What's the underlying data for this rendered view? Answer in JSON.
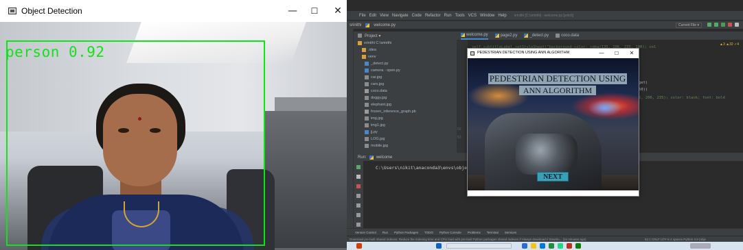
{
  "left_window": {
    "title": "Object Detection",
    "controls": {
      "minimize": "—",
      "maximize": "☐",
      "close": "✕"
    },
    "detection": {
      "label": "person 0.92",
      "box_color": "#15e01c"
    }
  },
  "ide": {
    "menu": [
      "File",
      "Edit",
      "View",
      "Navigate",
      "Code",
      "Refactor",
      "Run",
      "Tools",
      "VCS",
      "Window",
      "Help"
    ],
    "window_title": "srinithi [C:\\srinithi] - welcome.py [yolo5]",
    "breadcrumb": [
      "srinithi",
      "welcome.py"
    ],
    "nav_right": {
      "config": "Current File ▾"
    },
    "project_header": "Project ▾",
    "tree": [
      {
        "label": "srinithi  C:\\srinithi",
        "kind": "folder"
      },
      {
        "label": ".idea",
        "kind": "folder"
      },
      {
        "label": "venv",
        "kind": "folder"
      },
      {
        "label": "_detect.py",
        "kind": "py"
      },
      {
        "label": "camera - open.py",
        "kind": "py"
      },
      {
        "label": "car.jpg",
        "kind": "img"
      },
      {
        "label": "cars.jpg",
        "kind": "img"
      },
      {
        "label": "coco.data",
        "kind": "data"
      },
      {
        "label": "doggy.jpg",
        "kind": "img"
      },
      {
        "label": "elephant.jpg",
        "kind": "img"
      },
      {
        "label": "frozen_inference_graph.pb",
        "kind": "data"
      },
      {
        "label": "img.jpg",
        "kind": "img"
      },
      {
        "label": "img1.jpg",
        "kind": "img"
      },
      {
        "label": "jj.py",
        "kind": "py"
      },
      {
        "label": "LOG.jpg",
        "kind": "img"
      },
      {
        "label": "mobile.jpg",
        "kind": "img"
      }
    ],
    "tabs": [
      {
        "label": "welcome.py",
        "active": true
      },
      {
        "label": "page2.py",
        "active": false
      },
      {
        "label": "_detect.py",
        "active": false
      },
      {
        "label": "coco.data",
        "active": false
      }
    ],
    "code_line_1": "self.subtitleLabel.setStyleSheet(\"background-color: rgba(135, 206, 235, 100); col",
    "code_line_2": "get)",
    "code_line_3": "50))",
    "code_line_4": "5, 206, 235); color: black; font: bold",
    "line_numbers": [
      "52",
      "53"
    ],
    "warnings": "▲3 ▲32 ✓4",
    "run_header": {
      "run": "Run:",
      "config": "welcome"
    },
    "run_output": "C:\\Users\\nikit\\anaconda3\\envs\\objec",
    "bottom_tabs": [
      "Version Control",
      "Run",
      "Python Packages",
      "TODO",
      "Python Console",
      "Problems",
      "Terminal",
      "Services"
    ],
    "status_message": "Download pre-built shared indexes: Reduce the indexing time and CPU load with pre-built Python packages shared indexes // Always download // Downlo... (24 minutes ago)",
    "status_info": "52:1  CRLF  UTF-8  4 spaces  Python 3.9 (obje"
  },
  "popup": {
    "title": "PEDESTRIAN DETECTION USING ANN ALGORITHM",
    "heading_line1": "PEDESTRIAN DETECTION USING",
    "heading_line2": "ANN ALGORITHM",
    "next_button": "NEXT",
    "controls": {
      "minimize": "—",
      "maximize": "☐",
      "close": "✕"
    }
  }
}
